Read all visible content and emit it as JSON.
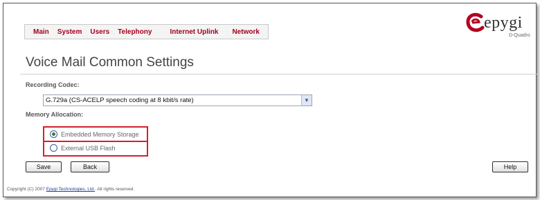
{
  "nav": {
    "items": [
      "Main",
      "System",
      "Users",
      "Telephony",
      "Internet Uplink",
      "Network"
    ]
  },
  "brand": {
    "logo_text": "epygi",
    "logo_sub": "D-Quadro",
    "accent_color": "#a3001c",
    "highlight_color": "#d51f2b"
  },
  "page": {
    "title": "Voice Mail Common Settings"
  },
  "recording_codec": {
    "label": "Recording Codec:",
    "selected": "G.729a (CS-ACELP speech coding at 8 kbit/s rate)"
  },
  "memory": {
    "label": "Memory Allocation:",
    "options": [
      {
        "label": "Embedded Memory Storage",
        "checked": true
      },
      {
        "label": "External USB Flash",
        "checked": false
      }
    ]
  },
  "buttons": {
    "save": "Save",
    "back": "Back",
    "help": "Help"
  },
  "footer": {
    "prefix": "Copyright (C) 2007",
    "link": "Epygi Technologies, Ltd.",
    "suffix": "All rights reserved."
  }
}
